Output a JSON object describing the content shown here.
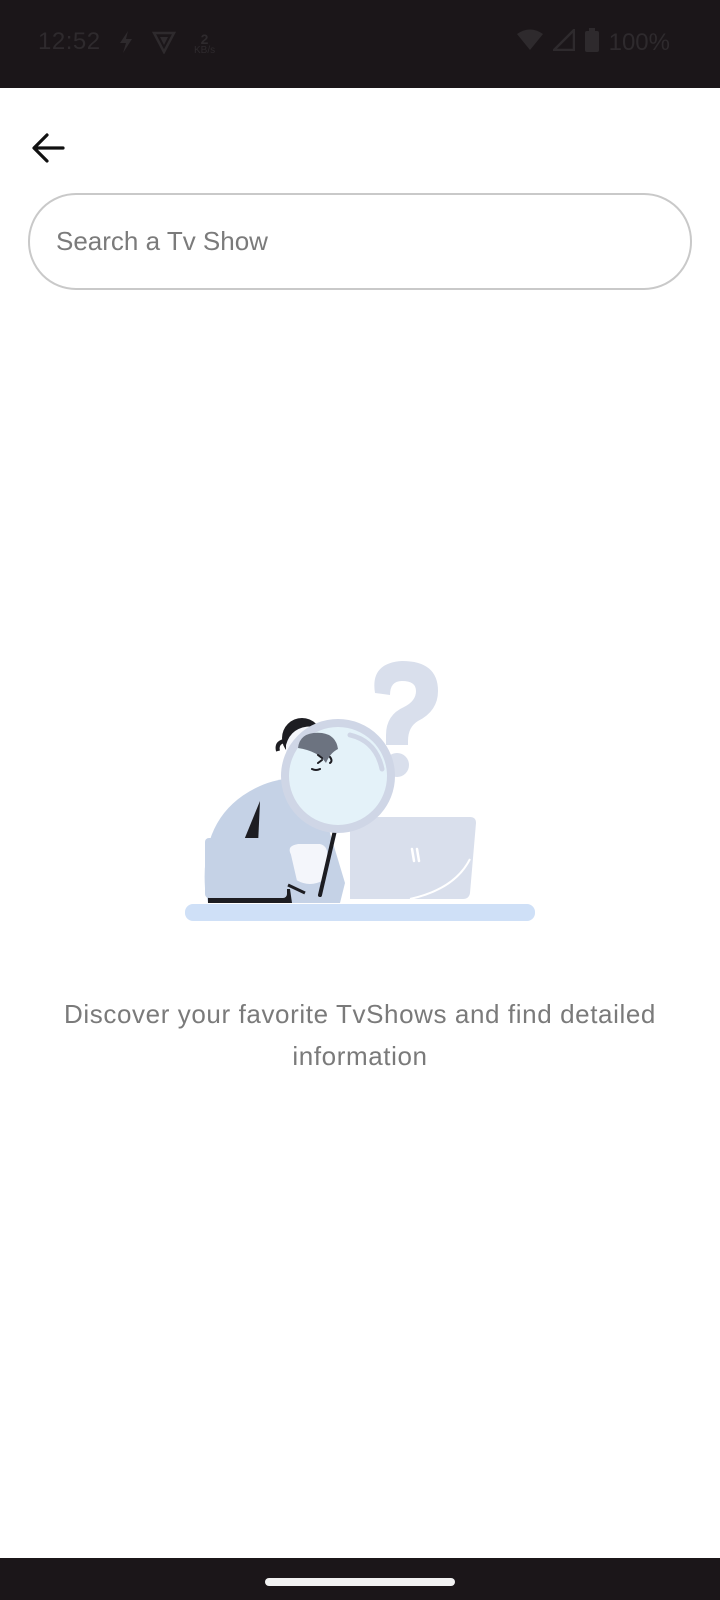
{
  "status_bar": {
    "time": "12:52",
    "data_speed_value": "2",
    "data_speed_unit": "KB/s",
    "battery": "100%"
  },
  "toolbar": {
    "back_icon": "arrow-left-icon"
  },
  "search": {
    "placeholder": "Search a Tv Show",
    "value": ""
  },
  "empty_state": {
    "illustration": "person-magnifier-laptop-question-mark",
    "message": "Discover your favorite TvShows and find detailed information"
  },
  "colors": {
    "status_bar_bg": "#1b1619",
    "illustration_primary": "#c5d2e6",
    "illustration_light": "#d9dfec",
    "illustration_desk": "#cfe0f7",
    "message_text": "#7a7a7a"
  }
}
